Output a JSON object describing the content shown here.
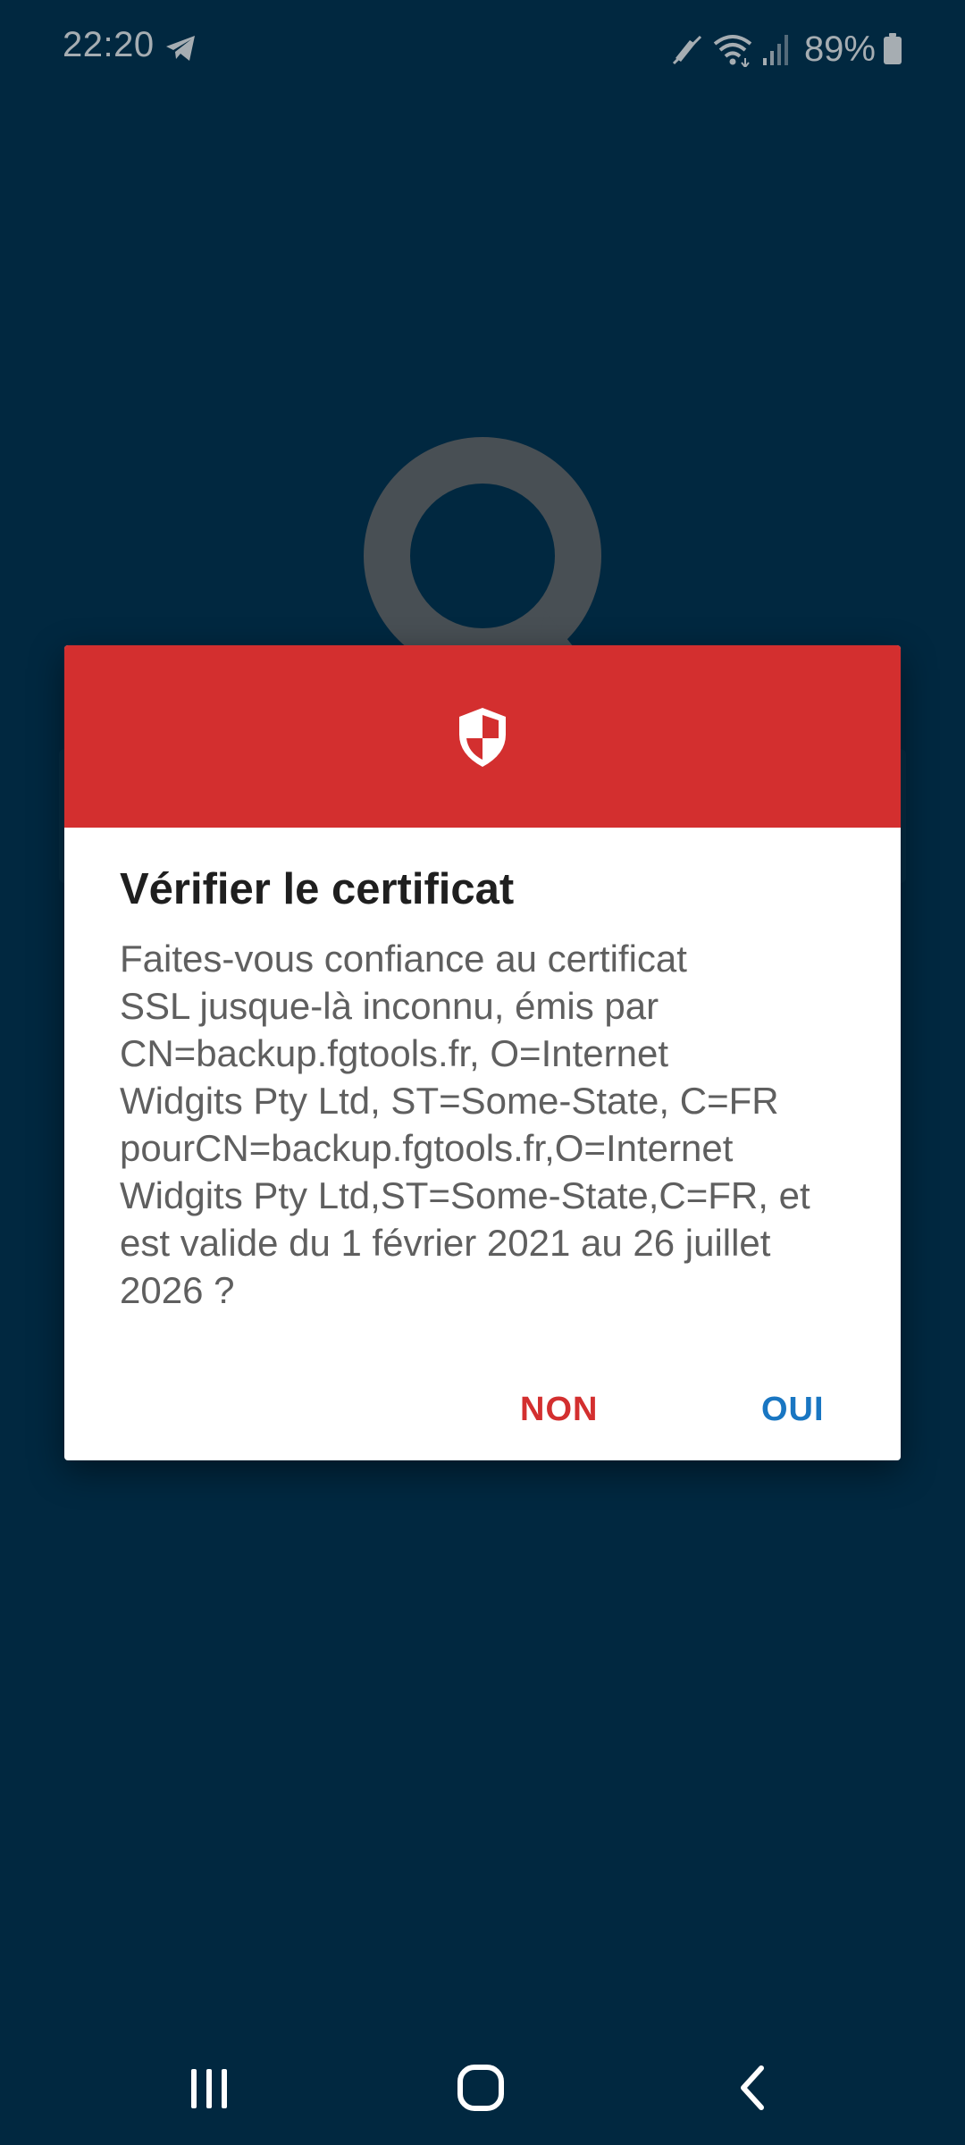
{
  "status_bar": {
    "time": "22:20",
    "battery_percent": "89%",
    "icons": [
      "telegram-icon",
      "no-alarm-icon",
      "wifi-icon",
      "signal-icon",
      "battery-icon"
    ]
  },
  "dialog": {
    "header_color": "#d32f2f",
    "header_icon": "shield-icon",
    "title": "Vérifier le certificat",
    "message": "Faites-vous confiance au certificat\nSSL jusque-là inconnu, émis par\nCN=backup.fgtools.fr, O=Internet\nWidgits Pty Ltd, ST=Some-State, C=FR\npourCN=backup.fgtools.fr,O=Internet\nWidgits Pty Ltd,ST=Some-State,C=FR, et\nest valide du 1 février 2021 au 26 juillet\n2026 ?",
    "negative_label": "NON",
    "positive_label": "OUI"
  },
  "colors": {
    "background": "#023350",
    "negative": "#d32f2f",
    "positive": "#1976c2"
  },
  "nav_bar": {
    "icons": [
      "recents-icon",
      "home-icon",
      "back-icon"
    ]
  }
}
